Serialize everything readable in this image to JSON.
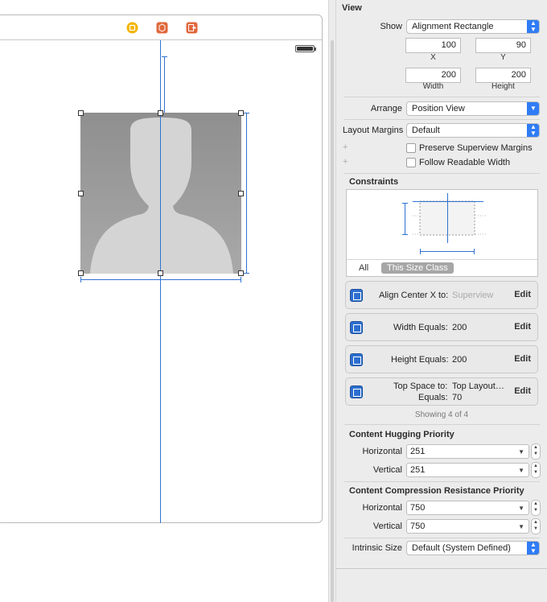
{
  "inspector": {
    "view_title": "View",
    "show_label": "Show",
    "show_value": "Alignment Rectangle",
    "x_value": "100",
    "y_value": "90",
    "x_label": "X",
    "y_label": "Y",
    "width_value": "200",
    "height_value": "200",
    "width_label": "Width",
    "height_label": "Height",
    "arrange_label": "Arrange",
    "arrange_value": "Position View",
    "layout_margins_label": "Layout Margins",
    "layout_margins_value": "Default",
    "preserve_margins_label": "Preserve Superview Margins",
    "follow_readable_label": "Follow Readable Width",
    "plus": "+"
  },
  "constraints": {
    "title": "Constraints",
    "tab_all": "All",
    "tab_size_class": "This Size Class",
    "items": [
      {
        "text": "Align Center X to:",
        "target": "Superview",
        "edit": "Edit"
      },
      {
        "text": "Width Equals:",
        "value": "200",
        "edit": "Edit"
      },
      {
        "text": "Height Equals:",
        "value": "200",
        "edit": "Edit"
      },
      {
        "text": "Top Space to:",
        "target": "Top Layout…",
        "line2": "Equals:",
        "value": "70",
        "edit": "Edit"
      }
    ],
    "showing": "Showing 4 of 4"
  },
  "hugging": {
    "title": "Content Hugging Priority",
    "horizontal_label": "Horizontal",
    "horizontal_value": "251",
    "vertical_label": "Vertical",
    "vertical_value": "251"
  },
  "compression": {
    "title": "Content Compression Resistance Priority",
    "horizontal_label": "Horizontal",
    "horizontal_value": "750",
    "vertical_label": "Vertical",
    "vertical_value": "750"
  },
  "intrinsic": {
    "label": "Intrinsic Size",
    "value": "Default (System Defined)"
  },
  "colors": {
    "accent": "#2f7cf6",
    "guide": "#2f72d1",
    "dock_yellow": "#f4b400",
    "dock_red": "#e0683c"
  }
}
